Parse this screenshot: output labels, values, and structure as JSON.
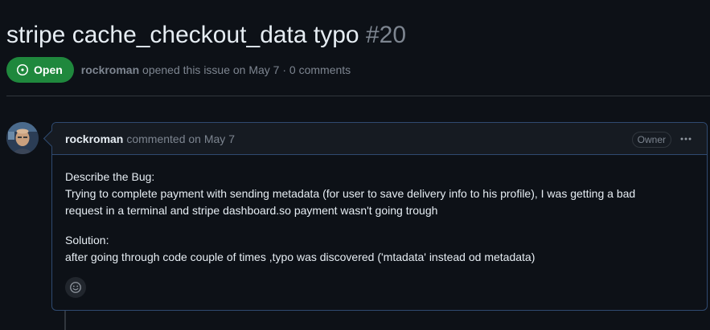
{
  "issue": {
    "title": "stripe cache_checkout_data typo",
    "number": "#20",
    "state": "Open",
    "author": "rockroman",
    "opened_text": "opened this issue on May 7 · 0 comments"
  },
  "comment": {
    "author": "rockroman",
    "timestamp": "commented on May 7",
    "role_badge": "Owner",
    "body": {
      "heading1": "Describe the Bug:",
      "line1": "Trying to complete payment with sending metadata (for user to save delivery info to his profile), I was getting a bad",
      "line2": "request in a terminal and stripe dashboard.so payment wasn't going trough",
      "heading2": "Solution:",
      "line3": "after going through code couple of times ,typo was discovered ('mtadata' instead od metadata)"
    }
  },
  "icons": {
    "state": "issue-open-icon",
    "menu": "kebab-horizontal-icon",
    "reaction": "smiley-icon"
  },
  "colors": {
    "open_green": "#1f883d",
    "background": "#0d1117",
    "comment_border": "#2f4a70",
    "muted_text": "#7d8590"
  }
}
